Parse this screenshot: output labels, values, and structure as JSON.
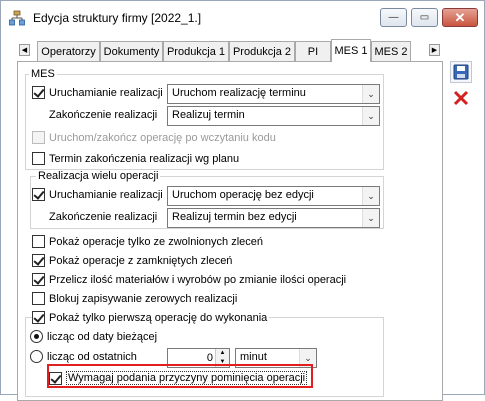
{
  "window": {
    "title": "Edycja struktury firmy [2022_1.]"
  },
  "tabs": [
    {
      "label": "Operatorzy"
    },
    {
      "label": "Dokumenty"
    },
    {
      "label": "Produkcja 1"
    },
    {
      "label": "Produkcja 2"
    },
    {
      "label": "PI"
    },
    {
      "label": "MES 1"
    },
    {
      "label": "MES 2"
    }
  ],
  "mes": {
    "group_title": "MES",
    "start_label": "Uruchamianie realizacji",
    "start_value": "Uruchom realizację terminu",
    "end_label": "Zakończenie realizacji",
    "end_value": "Realizuj termin",
    "scan_label": "Uruchom/zakończ operację po wczytaniu kodu",
    "plan_label": "Termin zakończenia realizacji wg planu"
  },
  "multi": {
    "group_title": "Realizacja wielu operacji",
    "start_label": "Uruchamianie realizacji",
    "start_value": "Uruchom operację bez edycji",
    "end_label": "Zakończenie realizacji",
    "end_value": "Realizuj termin bez edycji"
  },
  "options": {
    "released_label": "Pokaż operacje tylko ze zwolnionych zleceń",
    "closed_label": "Pokaż operacje z zamkniętych zleceń",
    "recalc_label": "Przelicz ilość materiałów i wyrobów po zmianie ilości operacji",
    "zero_label": "Blokuj zapisywanie zerowych realizacji",
    "first_label": "Pokaż tylko pierwszą operację do wykonania",
    "count_date_label": "licząc od daty bieżącej",
    "count_last_label": "licząc od ostatnich",
    "count_last_value": "0",
    "count_unit": "minut",
    "skip_reason_label": "Wymagaj podania przyczyny pominięcia operacji"
  }
}
